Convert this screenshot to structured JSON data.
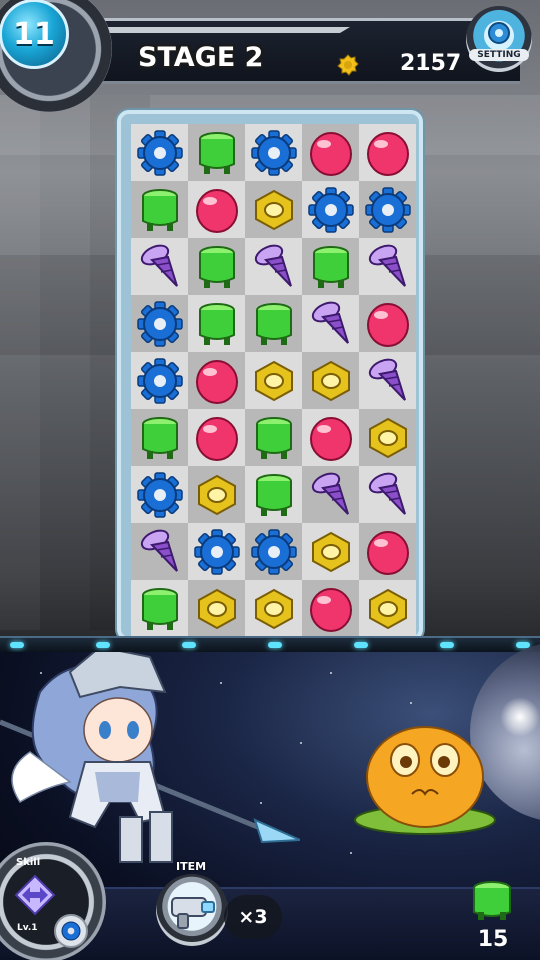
{
  "header": {
    "moves_left": "11",
    "stage_label": "STAGE 2",
    "score": "2157",
    "setting_label": "SETTING",
    "coin_icon": "coin-icon"
  },
  "board": {
    "rows": 9,
    "cols": 5,
    "pieces": [
      [
        "gear",
        "cylinder",
        "gear",
        "ball",
        "ball"
      ],
      [
        "cylinder",
        "ball",
        "nut",
        "gear",
        "gear"
      ],
      [
        "screw",
        "cylinder",
        "screw",
        "cylinder",
        "screw"
      ],
      [
        "gear",
        "cylinder",
        "cylinder",
        "screw",
        "ball"
      ],
      [
        "gear",
        "ball",
        "nut",
        "nut",
        "screw"
      ],
      [
        "cylinder",
        "ball",
        "cylinder",
        "ball",
        "nut"
      ],
      [
        "gear",
        "nut",
        "cylinder",
        "screw",
        "screw"
      ],
      [
        "screw",
        "gear",
        "gear",
        "nut",
        "ball"
      ],
      [
        "cylinder",
        "nut",
        "nut",
        "ball",
        "nut"
      ]
    ],
    "piece_colors": {
      "gear": "#1a6fd6",
      "cylinder": "#3fcf3a",
      "ball": "#f0356d",
      "nut": "#e6c21c",
      "screw": "#8a4fc9"
    }
  },
  "battle": {
    "skill_label": "Skill",
    "skill_level": "Lv.1",
    "item_label": "ITEM",
    "item_count": "×3",
    "goal_piece": "cylinder",
    "goal_count": "15"
  }
}
